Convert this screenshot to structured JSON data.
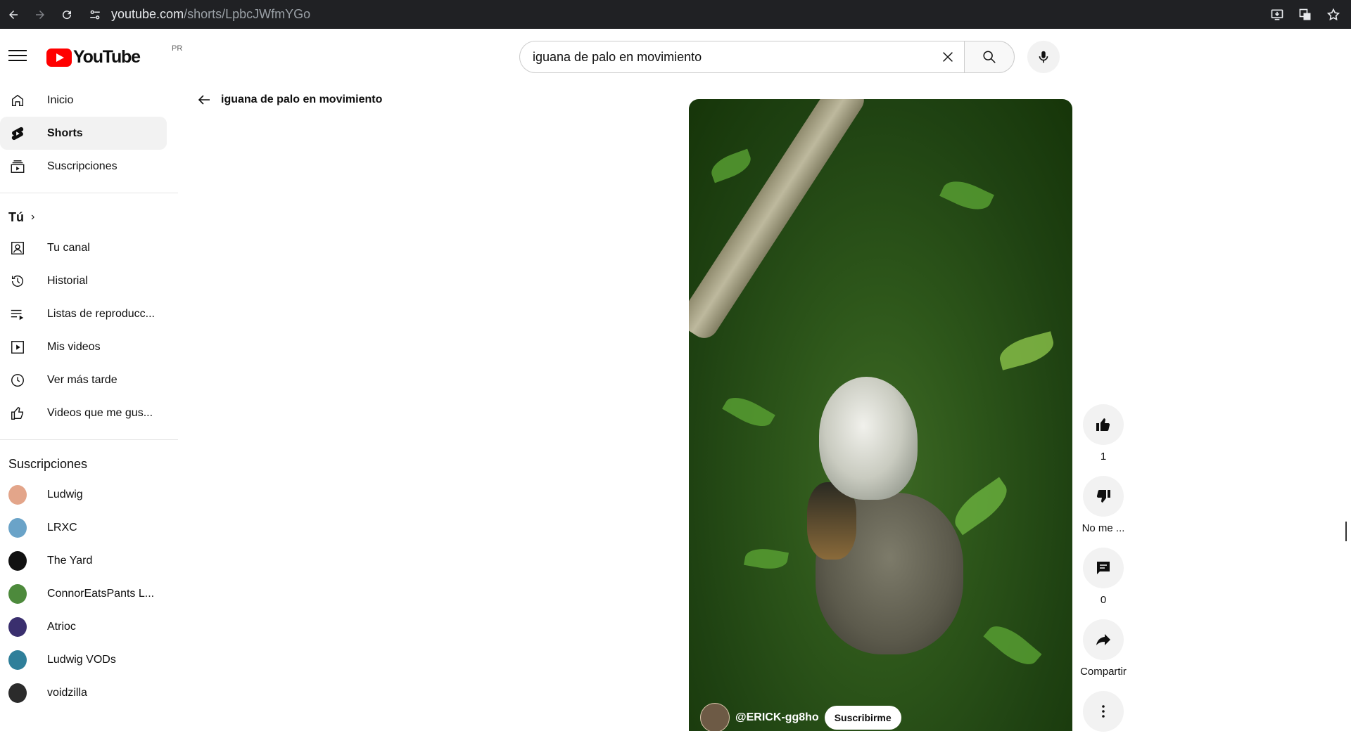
{
  "browser": {
    "url_host": "youtube.com",
    "url_path": "/shorts/LpbcJWfmYGo"
  },
  "masthead": {
    "logo_text": "YouTube",
    "country_code": "PR",
    "search_query": "iguana de palo en movimiento"
  },
  "sidebar": {
    "main": [
      {
        "label": "Inicio",
        "icon": "home-icon"
      },
      {
        "label": "Shorts",
        "icon": "shorts-icon",
        "active": true
      },
      {
        "label": "Suscripciones",
        "icon": "subscriptions-icon"
      }
    ],
    "you_heading": "Tú",
    "you": [
      {
        "label": "Tu canal",
        "icon": "your-channel-icon"
      },
      {
        "label": "Historial",
        "icon": "history-icon"
      },
      {
        "label": "Listas de reproducc...",
        "icon": "playlists-icon"
      },
      {
        "label": "Mis videos",
        "icon": "your-videos-icon"
      },
      {
        "label": "Ver más tarde",
        "icon": "watch-later-icon"
      },
      {
        "label": "Videos que me gus...",
        "icon": "liked-videos-icon"
      }
    ],
    "subs_heading": "Suscripciones",
    "subscriptions": [
      {
        "label": "Ludwig",
        "color": "#e3a58a"
      },
      {
        "label": "LRXC",
        "color": "#6aa3c8"
      },
      {
        "label": "The Yard",
        "color": "#111111"
      },
      {
        "label": "ConnorEatsPants L...",
        "color": "#4d8a3c"
      },
      {
        "label": "Atrioc",
        "color": "#3a2f6e"
      },
      {
        "label": "Ludwig VODs",
        "color": "#2f7f9a"
      },
      {
        "label": "voidzilla",
        "color": "#2b2b2b"
      }
    ]
  },
  "back": {
    "label": "iguana de palo en movimiento"
  },
  "video": {
    "channel_handle": "@ERICK-gg8ho",
    "subscribe_label": "Suscribirme"
  },
  "actions": {
    "like_count": "1",
    "dislike_label": "No me ...",
    "comments_count": "0",
    "share_label": "Compartir"
  }
}
